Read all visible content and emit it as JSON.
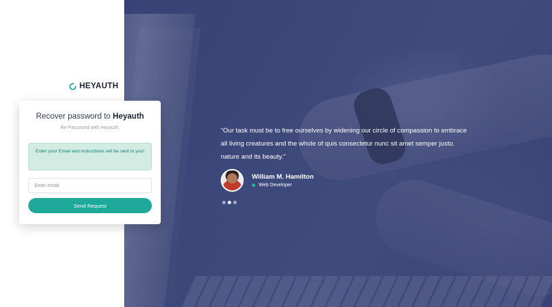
{
  "brand": {
    "name": "HEYAUTH",
    "icon": "refresh-ring-icon",
    "accent_color": "#1fa99b"
  },
  "card": {
    "title_prefix": "Recover password to",
    "title_brand": "Heyauth",
    "subtitle": "Re-Password with Heyauth.",
    "alert_text": "Enter your Email and instructions will be sent to you!",
    "email_placeholder": "Enter email",
    "email_value": "",
    "send_button_label": "Send Request"
  },
  "testimonial": {
    "quote": "“Our task must be to free ourselves by widening our circle of compassion to embrace all living creatures and the whole of quis consectetur nunc sit amet semper justo. nature and its beauty.”",
    "author_name": "William M. Hamilton",
    "author_role": "Web Developer",
    "status_color": "#1fb39f",
    "carousel": {
      "total": 3,
      "active": 2
    }
  }
}
